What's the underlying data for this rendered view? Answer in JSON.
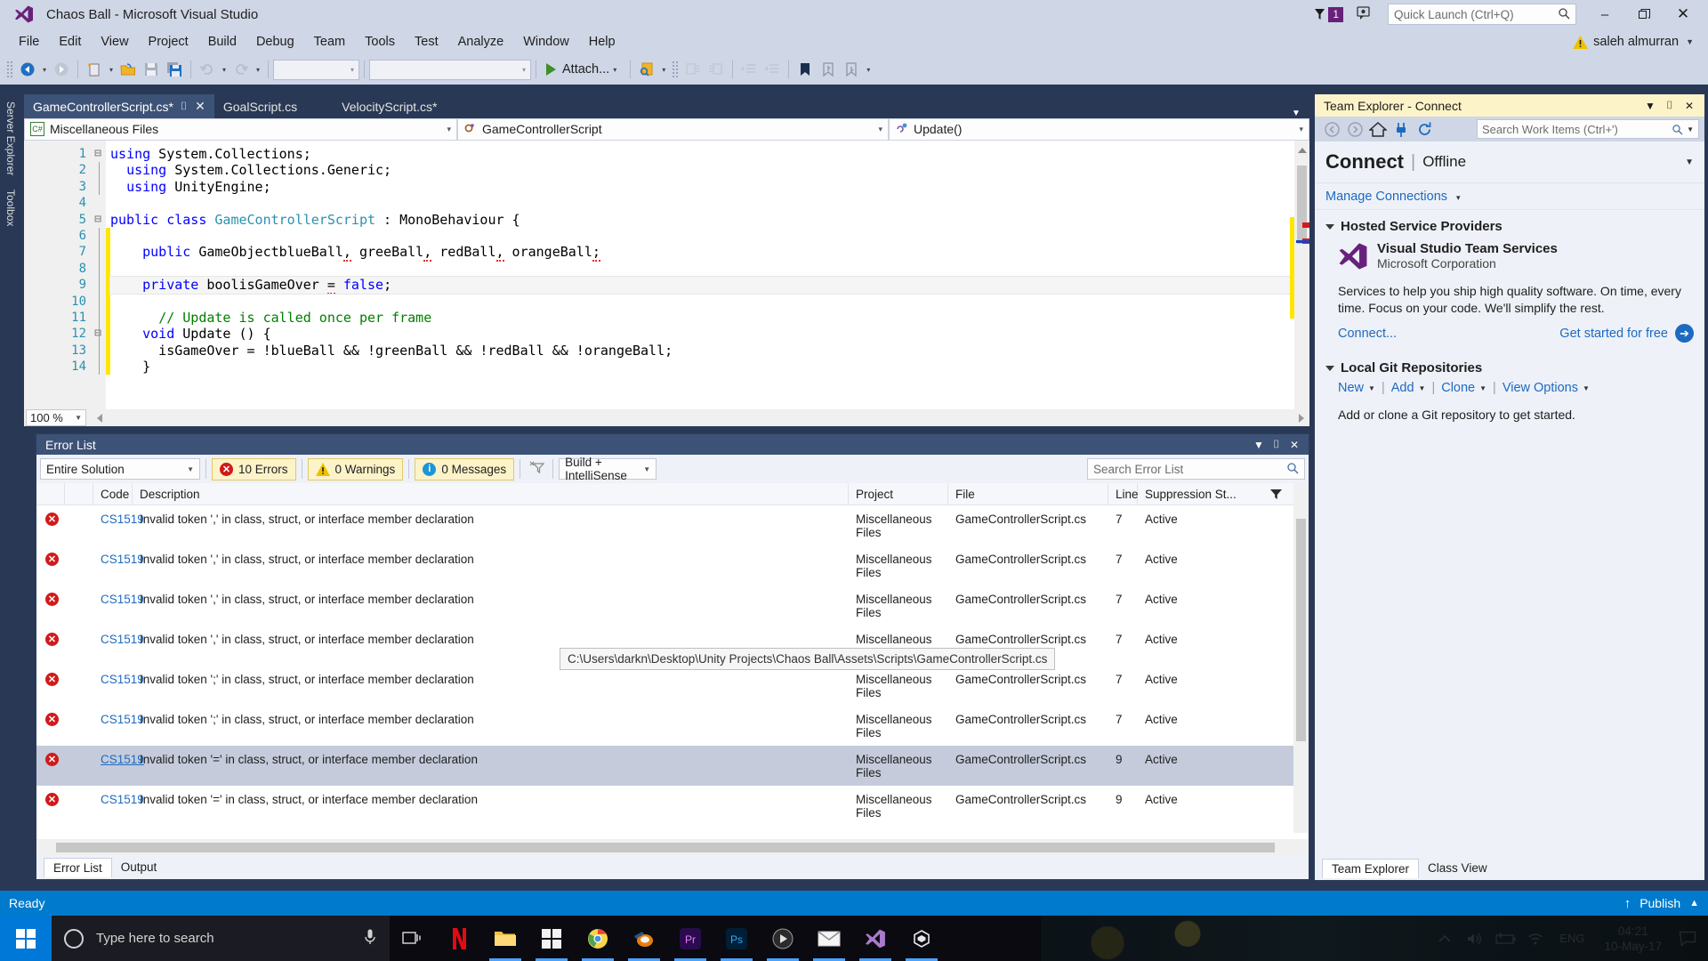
{
  "titlebar": {
    "app_title": "Chaos Ball - Microsoft Visual Studio",
    "logo_icon": "visual-studio-logo-icon",
    "notification_flag_icon": "notification-flag-icon",
    "notification_count": "1",
    "feedback_icon": "feedback-smiley-icon",
    "quick_launch_placeholder": "Quick Launch (Ctrl+Q)",
    "search_icon": "search-magnifier-icon",
    "minimize": "–",
    "maximize": "❐",
    "close": "✕"
  },
  "menubar": {
    "items": [
      "File",
      "Edit",
      "View",
      "Project",
      "Build",
      "Debug",
      "Team",
      "Tools",
      "Test",
      "Analyze",
      "Window",
      "Help"
    ],
    "user_name": "saleh almurran",
    "user_warning_icon": "warning-triangle-icon",
    "user_caret": "▼"
  },
  "toolbar": {
    "nav_back_icon": "navigate-backward-icon",
    "nav_forward_icon": "navigate-forward-icon",
    "new_item_icon": "new-item-icon",
    "open_file_icon": "open-file-icon",
    "save_icon": "save-icon",
    "save_all_icon": "save-all-icon",
    "undo_icon": "undo-icon",
    "redo_icon": "redo-icon",
    "combo1_value": "",
    "combo2_value": "",
    "attach_label": "Attach...",
    "attach_play_icon": "start-debug-play-icon",
    "find_icon": "find-in-files-icon",
    "comment_icon": "comment-selection-icon",
    "uncomment_icon": "uncomment-selection-icon",
    "indent_icon": "increase-indent-icon",
    "outdent_icon": "decrease-indent-icon",
    "bookmark_icon": "bookmark-icon",
    "prev_bookmark_icon": "previous-bookmark-icon",
    "next_bookmark_icon": "next-bookmark-icon",
    "overflow_icon": "toolbar-overflow-icon",
    "dropdown_caret": "▾"
  },
  "leftdock": {
    "tabs": [
      "Server Explorer",
      "Toolbox"
    ]
  },
  "editor": {
    "tabs": [
      {
        "label": "GameControllerScript.cs*",
        "active": true,
        "pin_icon": "pin-icon",
        "close_icon": "close-tab-icon"
      },
      {
        "label": "GoalScript.cs",
        "active": false
      },
      {
        "label": "VelocityScript.cs*",
        "active": false
      }
    ],
    "project_selector": "Miscellaneous Files",
    "project_icon": "csharp-file-icon",
    "class_selector": "GameControllerScript",
    "class_icon": "class-icon",
    "member_selector": "Update()",
    "member_icon": "method-icon",
    "dropdown_caret": "▾",
    "zoom_level": "100 %",
    "code_lines": [
      {
        "n": "1",
        "fold": "⊟",
        "html": "<span class=\"kw\">using</span> System.Collections;"
      },
      {
        "n": "2",
        "fold": "",
        "html": "  <span class=\"kw\">using</span> System.Collections.Generic;"
      },
      {
        "n": "3",
        "fold": "",
        "html": "  <span class=\"kw\">using</span> UnityEngine;"
      },
      {
        "n": "4",
        "fold": "",
        "html": ""
      },
      {
        "n": "5",
        "fold": "⊟",
        "html": "<span class=\"kw\">public</span> <span class=\"kw\">class</span> <span class=\"ty\">GameControllerScript</span> : MonoBehaviour {"
      },
      {
        "n": "6",
        "fold": "",
        "html": ""
      },
      {
        "n": "7",
        "fold": "",
        "html": "    <span class=\"kw\">public</span> GameObjectblueBall<span class=\"squig\">,</span> greeBall<span class=\"squig\">,</span> redBall<span class=\"squig\">,</span> orangeBall<span class=\"squig\">;</span>"
      },
      {
        "n": "8",
        "fold": "",
        "html": ""
      },
      {
        "n": "9",
        "fold": "",
        "html": "    <span class=\"kw\">private</span> boolisGameOver <span class=\"squig\">=</span> <span class=\"kw\">false</span>;"
      },
      {
        "n": "10",
        "fold": "",
        "html": ""
      },
      {
        "n": "11",
        "fold": "",
        "html": "      <span class=\"cm\">// Update is called once per frame</span>"
      },
      {
        "n": "12",
        "fold": "⊟",
        "html": "    <span class=\"kw\">void</span> Update () {"
      },
      {
        "n": "13",
        "fold": "",
        "html": "      isGameOver = !blueBall &amp;&amp; !greenBall &amp;&amp; !redBall &amp;&amp; !orangeBall;"
      },
      {
        "n": "14",
        "fold": "",
        "html": "    }"
      }
    ],
    "code_plain": [
      "using System.Collections;",
      "using System.Collections.Generic;",
      "using UnityEngine;",
      "",
      "public class GameControllerScript : MonoBehaviour {",
      "",
      "    public GameObjectblueBall, greeBall, redBall, orangeBall;",
      "",
      "    private boolisGameOver = false;",
      "",
      "      // Update is called once per frame",
      "    void Update () {",
      "      isGameOver = !blueBall && !greenBall && !redBall && !orangeBall;",
      "    }"
    ]
  },
  "errorlist": {
    "panel_title": "Error List",
    "dropdown_icon": "window-dropdown-icon",
    "pin_icon": "pin-icon",
    "close_icon": "close-icon",
    "scope_value": "Entire Solution",
    "errors_label": "10 Errors",
    "warnings_label": "0 Warnings",
    "messages_label": "0 Messages",
    "clear_filter_icon": "clear-filter-icon",
    "build_filter_value": "Build + IntelliSense",
    "search_placeholder": "Search Error List",
    "search_icon": "search-magnifier-icon",
    "filter_icon": "column-filter-icon",
    "columns": [
      "",
      "",
      "Code",
      "Description",
      "Project",
      "File",
      "Line",
      "Suppression St..."
    ],
    "rows": [
      {
        "icon": "error-icon",
        "code": "CS1519",
        "description": "Invalid token ',' in class, struct, or interface member declaration",
        "project": "Miscellaneous Files",
        "file": "GameControllerScript.cs",
        "line": "7",
        "suppression": "Active",
        "selected": false
      },
      {
        "icon": "error-icon",
        "code": "CS1519",
        "description": "Invalid token ',' in class, struct, or interface member declaration",
        "project": "Miscellaneous Files",
        "file": "GameControllerScript.cs",
        "line": "7",
        "suppression": "Active",
        "selected": false
      },
      {
        "icon": "error-icon",
        "code": "CS1519",
        "description": "Invalid token ',' in class, struct, or interface member declaration",
        "project": "Miscellaneous Files",
        "file": "GameControllerScript.cs",
        "line": "7",
        "suppression": "Active",
        "selected": false
      },
      {
        "icon": "error-icon",
        "code": "CS1519",
        "description": "Invalid token ',' in class, struct, or interface member declaration",
        "project": "Miscellaneous Files",
        "file": "GameControllerScript.cs",
        "line": "7",
        "suppression": "Active",
        "selected": false
      },
      {
        "icon": "error-icon",
        "code": "CS1519",
        "description": "Invalid token ';' in class, struct, or interface member declaration",
        "project": "Miscellaneous Files",
        "file": "GameControllerScript.cs",
        "line": "7",
        "suppression": "Active",
        "selected": false
      },
      {
        "icon": "error-icon",
        "code": "CS1519",
        "description": "Invalid token ';' in class, struct, or interface member declaration",
        "project": "Miscellaneous Files",
        "file": "GameControllerScript.cs",
        "line": "7",
        "suppression": "Active",
        "selected": false
      },
      {
        "icon": "error-icon",
        "code": "CS1519",
        "description": "Invalid token '=' in class, struct, or interface member declaration",
        "project": "Miscellaneous Files",
        "file": "GameControllerScript.cs",
        "line": "9",
        "suppression": "Active",
        "selected": true
      },
      {
        "icon": "error-icon",
        "code": "CS1519",
        "description": "Invalid token '=' in class, struct, or interface member declaration",
        "project": "Miscellaneous Files",
        "file": "GameControllerScript.cs",
        "line": "9",
        "suppression": "Active",
        "selected": false
      }
    ],
    "tooltip": "C:\\Users\\darkn\\Desktop\\Unity Projects\\Chaos Ball\\Assets\\Scripts\\GameControllerScript.cs",
    "bottom_tabs": [
      {
        "label": "Error List",
        "active": true
      },
      {
        "label": "Output",
        "active": false
      }
    ]
  },
  "teamexplorer": {
    "panel_title": "Team Explorer - Connect",
    "dropdown_icon": "window-dropdown-icon",
    "pin_icon": "pin-icon",
    "close_icon": "close-icon",
    "back_icon": "back-arrow-icon",
    "forward_icon": "forward-arrow-icon",
    "home_icon": "home-icon",
    "plug_icon": "connect-plug-icon",
    "refresh_icon": "refresh-icon",
    "search_placeholder": "Search Work Items (Ctrl+')",
    "search_icon": "search-magnifier-icon",
    "search_caret": "▾",
    "heading": "Connect",
    "status": "Offline",
    "manage_connections": "Manage Connections",
    "manage_caret": "▾",
    "hosted_section": "Hosted Service Providers",
    "provider_name": "Visual Studio Team Services",
    "provider_sub": "Microsoft Corporation",
    "provider_icon": "visual-studio-logo-icon",
    "provider_desc": "Services to help you ship high quality software. On time, every time. Focus on your code. We'll simplify the rest.",
    "connect_link": "Connect...",
    "get_started": "Get started for free",
    "get_started_icon": "arrow-right-circle-icon",
    "git_section": "Local Git Repositories",
    "git_actions": [
      "New",
      "Add",
      "Clone",
      "View Options"
    ],
    "git_note": "Add or clone a Git repository to get started.",
    "bottom_tabs": [
      {
        "label": "Team Explorer",
        "active": true
      },
      {
        "label": "Class View",
        "active": false
      }
    ]
  },
  "statusbar": {
    "status_text": "Ready",
    "publish_label": "Publish",
    "publish_up_icon": "upload-arrow-icon",
    "publish_caret": "▲"
  },
  "taskbar": {
    "start_icon": "windows-start-icon",
    "search_placeholder": "Type here to search",
    "cortana_icon": "cortana-circle-icon",
    "mic_icon": "microphone-icon",
    "taskview_icon": "task-view-icon",
    "apps": [
      {
        "icon": "netflix-icon",
        "active": false
      },
      {
        "icon": "file-explorer-icon",
        "active": true
      },
      {
        "icon": "microsoft-store-icon",
        "active": true
      },
      {
        "icon": "google-chrome-icon",
        "active": true
      },
      {
        "icon": "blender-icon",
        "active": true
      },
      {
        "icon": "adobe-premiere-icon",
        "active": true
      },
      {
        "icon": "adobe-photoshop-icon",
        "active": true
      },
      {
        "icon": "media-player-icon",
        "active": true
      },
      {
        "icon": "mail-icon",
        "active": true
      },
      {
        "icon": "visual-studio-icon",
        "active": true
      },
      {
        "icon": "unity-icon",
        "active": true
      }
    ],
    "tray_up_icon": "show-hidden-icons-icon",
    "volume_icon": "volume-icon",
    "battery_icon": "battery-charging-icon",
    "wifi_icon": "wifi-icon",
    "language": "ENG",
    "time": "04:21",
    "date": "10-May-17",
    "action_center_icon": "action-center-icon"
  },
  "colors": {
    "chrome": "#cfd6e6",
    "dark_blue": "#293955",
    "accent_blue": "#007acc",
    "link_blue": "#1d6ac1",
    "error_red": "#d11a1a",
    "warn_yellow": "#f0c000",
    "selection": "#c5cbdb",
    "highlight_yellow": "#fdf3c8",
    "purple": "#68217a"
  }
}
